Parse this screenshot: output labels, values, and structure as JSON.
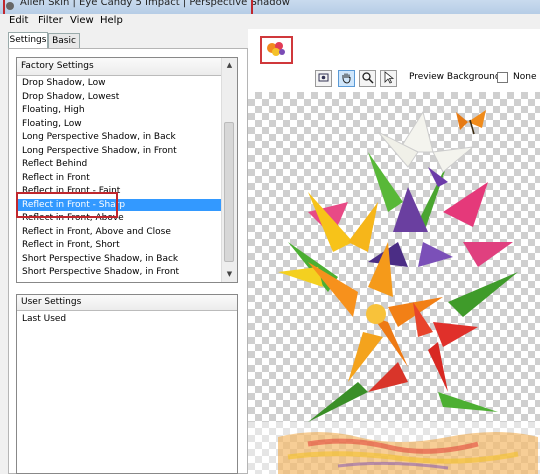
{
  "window": {
    "title": "Alien Skin | Eye Candy 5 Impact | Perspective Shadow",
    "menu": [
      "Edit",
      "Filter",
      "View",
      "Help"
    ]
  },
  "tabs": [
    {
      "label": "Settings"
    },
    {
      "label": "Basic"
    }
  ],
  "factory": {
    "header": "Factory Settings",
    "items": [
      {
        "label": "Drop Shadow, Low"
      },
      {
        "label": "Drop Shadow, Lowest"
      },
      {
        "label": "Floating, High"
      },
      {
        "label": "Floating, Low"
      },
      {
        "label": "Long Perspective Shadow, in Back"
      },
      {
        "label": "Long Perspective Shadow, in Front"
      },
      {
        "label": "Reflect Behind"
      },
      {
        "label": "Reflect in Front"
      },
      {
        "label": "Reflect in Front - Faint"
      },
      {
        "label": "Reflect in Front - Sharp"
      },
      {
        "label": "Reflect in Front, Above"
      },
      {
        "label": "Reflect in Front, Above and Close"
      },
      {
        "label": "Reflect in Front, Short"
      },
      {
        "label": "Short Perspective Shadow, in Back"
      },
      {
        "label": "Short Perspective Shadow, in Front"
      }
    ],
    "selected": "Reflect in Front - Sharp"
  },
  "user": {
    "header": "User Settings",
    "items": [
      {
        "label": "Last Used"
      }
    ]
  },
  "preview": {
    "background_label": "Preview Background:",
    "background_value": "None"
  },
  "toolbar_icons": [
    "navigator-icon",
    "hand-icon",
    "zoom-icon",
    "pointer-icon"
  ],
  "colors": {
    "selection": "#3399ff",
    "highlight": "#c0272d"
  }
}
